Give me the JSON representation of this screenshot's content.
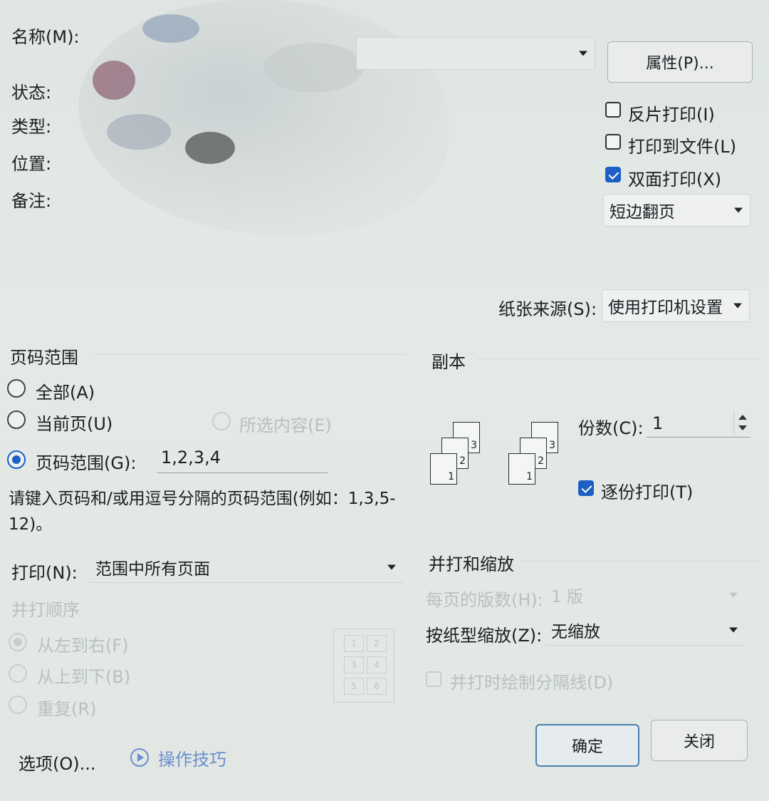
{
  "printer": {
    "name_label": "名称(M):",
    "status_label": "状态:",
    "type_label": "类型:",
    "location_label": "位置:",
    "comment_label": "备注:",
    "properties_button": "属性(P)..."
  },
  "options": {
    "reverse_print": {
      "label": "反片打印(I)",
      "checked": false
    },
    "print_to_file": {
      "label": "打印到文件(L)",
      "checked": false
    },
    "duplex": {
      "label": "双面打印(X)",
      "checked": true
    },
    "duplex_mode": "短边翻页"
  },
  "paper_source": {
    "label": "纸张来源(S):",
    "value": "使用打印机设置"
  },
  "page_range": {
    "title": "页码范围",
    "all_label": "全部(A)",
    "current_label": "当前页(U)",
    "selection_label": "所选内容(E)",
    "range_label": "页码范围(G):",
    "range_value": "1,2,3,4",
    "hint": "请键入页码和/或用逗号分隔的页码范围(例如：1,3,5-12)。"
  },
  "print_what": {
    "label": "打印(N):",
    "value": "范围中所有页面"
  },
  "collate_order": {
    "title": "并打顺序",
    "left_to_right": "从左到右(F)",
    "top_to_bottom": "从上到下(B)",
    "repeat": "重复(R)",
    "preview_numbers": [
      "1",
      "2",
      "3",
      "4",
      "5",
      "6"
    ]
  },
  "copies": {
    "title": "副本",
    "count_label": "份数(C):",
    "count_value": "1",
    "collate_label": "逐份打印(T)",
    "collate_checked": true,
    "page_numbers": [
      "1",
      "2",
      "3"
    ]
  },
  "zoom": {
    "title": "并打和缩放",
    "pages_per_sheet_label": "每页的版数(H):",
    "pages_per_sheet_value": "1 版",
    "scale_label": "按纸型缩放(Z):",
    "scale_value": "无缩放",
    "draw_borders_label": "并打时绘制分隔线(D)"
  },
  "footer": {
    "options_button": "选项(O)...",
    "tips_link": "操作技巧",
    "ok_button": "确定",
    "close_button": "关闭"
  }
}
